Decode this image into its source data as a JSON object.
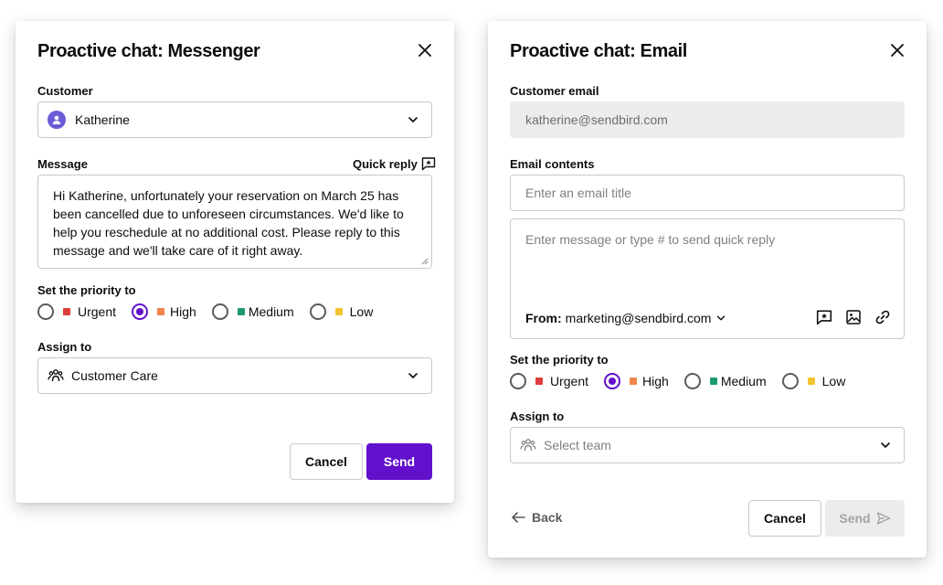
{
  "messenger_dialog": {
    "title": "Proactive chat: Messenger",
    "customer_label": "Customer",
    "customer_value": "Katherine",
    "message_label": "Message",
    "quick_reply_label": "Quick reply",
    "message_text": "Hi Katherine, unfortunately your reservation on March 25 has been cancelled due to unforeseen circumstances. We'd like to help you reschedule at no additional cost. Please reply to this message and we'll take care of it right away.",
    "priority_label": "Set the priority to",
    "priorities": [
      {
        "label": "Urgent",
        "color": "#de3c3c",
        "checked": false
      },
      {
        "label": "High",
        "color": "#f0844c",
        "checked": true
      },
      {
        "label": "Medium",
        "color": "#1d9a6c",
        "checked": false
      },
      {
        "label": "Low",
        "color": "#f4c430",
        "checked": false
      }
    ],
    "assign_label": "Assign to",
    "assign_value": "Customer Care",
    "cancel_label": "Cancel",
    "send_label": "Send"
  },
  "email_dialog": {
    "title": "Proactive chat: Email",
    "customer_email_label": "Customer email",
    "customer_email_value": "katherine@sendbird.com",
    "email_contents_label": "Email contents",
    "title_placeholder": "Enter an email title",
    "message_placeholder": "Enter message or type # to send quick reply",
    "from_label": "From:",
    "from_value": "marketing@sendbird.com",
    "priority_label": "Set the priority to",
    "priorities": [
      {
        "label": "Urgent",
        "color": "#de3c3c",
        "checked": false
      },
      {
        "label": "High",
        "color": "#f0844c",
        "checked": true
      },
      {
        "label": "Medium",
        "color": "#1d9a6c",
        "checked": false
      },
      {
        "label": "Low",
        "color": "#f4c430",
        "checked": false
      }
    ],
    "assign_label": "Assign to",
    "assign_placeholder": "Select team",
    "back_label": "Back",
    "cancel_label": "Cancel",
    "send_label": "Send"
  },
  "theme": {
    "primary": "#6210cc",
    "avatar": "#6b5bd6",
    "disabled_bg": "#ececec",
    "border": "#c9c9c9"
  },
  "icons": [
    "close-icon",
    "chevron-down-icon",
    "user-icon",
    "quick-reply-icon",
    "team-icon",
    "image-icon",
    "link-icon",
    "arrow-left-icon",
    "send-icon"
  ]
}
